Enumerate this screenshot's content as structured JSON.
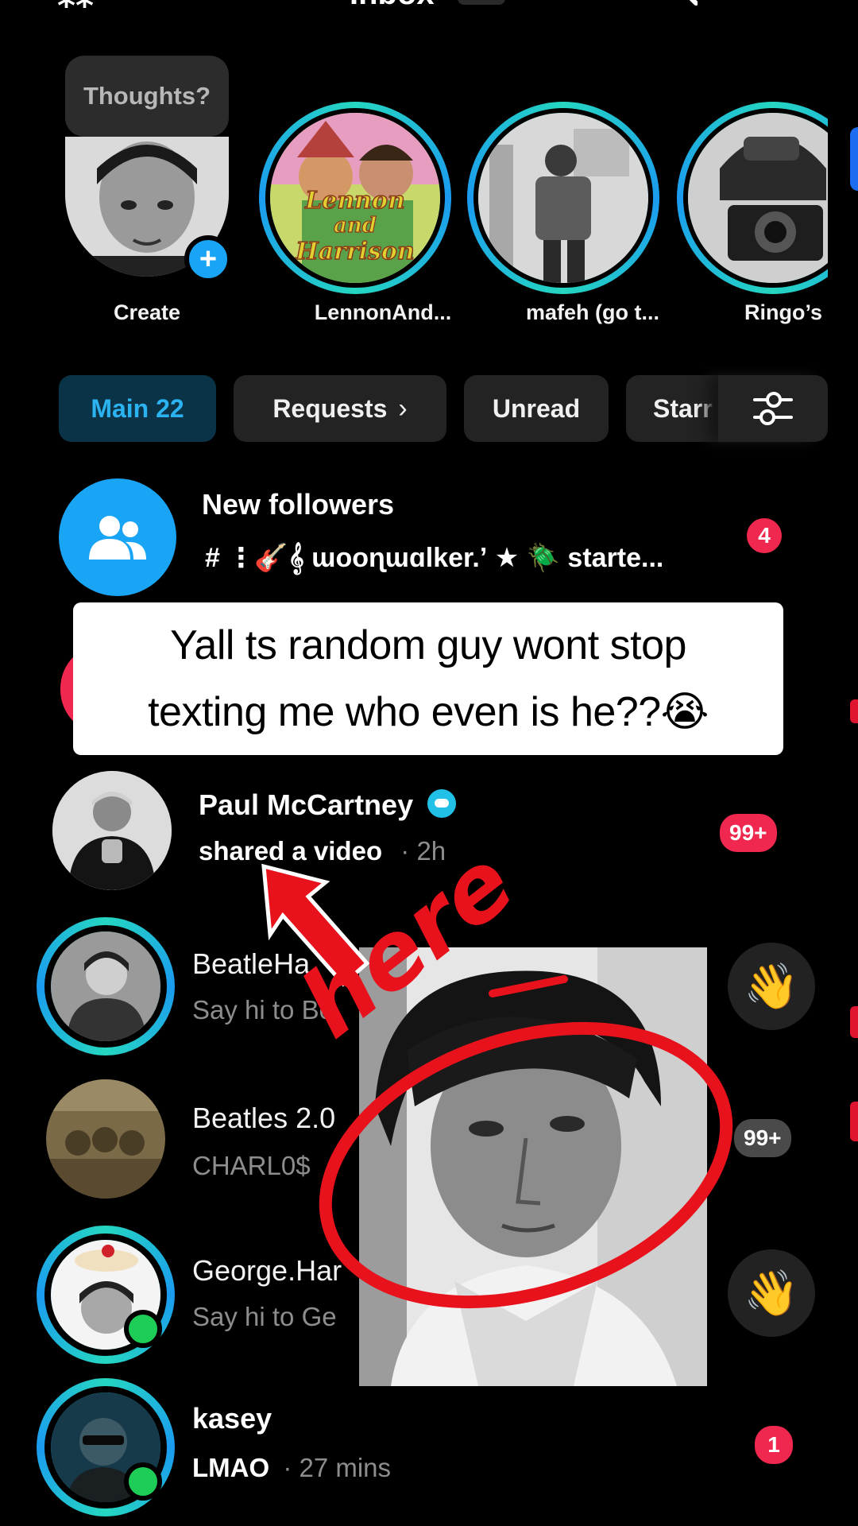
{
  "header": {
    "title": "Inbox",
    "search_icon": "search-icon"
  },
  "stories": {
    "thought_bubble": "Thoughts?",
    "items": [
      {
        "label": "Create"
      },
      {
        "label": "LennonAnd..."
      },
      {
        "label": "mafeh (go t..."
      },
      {
        "label": "Ringo’s left"
      }
    ],
    "lennon_art_text": [
      "Lennon",
      "and",
      "Harrison"
    ]
  },
  "tabs": {
    "main": "Main 22",
    "requests": "Requests",
    "unread": "Unread",
    "starred": "Starr",
    "filter_icon": "sliders-icon"
  },
  "rows": [
    {
      "title": "New followers",
      "subtitle": "# ⋮🎸𝄞 ɯooɳɯɑlker.ʼ ★ 🪲 starte...",
      "badge": "4"
    },
    {
      "title": "Paul McCartney",
      "subtitle": "shared a video",
      "time": "· 2h",
      "badge": "99+"
    },
    {
      "title": "BeatleHa",
      "subtitle": "Say hi to Be",
      "action": "wave"
    },
    {
      "title": "Beatles 2.0",
      "subtitle": "CHARL0$",
      "badge": "99+"
    },
    {
      "title": "George.Har",
      "subtitle": "Say hi to Ge",
      "action": "wave"
    },
    {
      "title": "kasey",
      "subtitle": "LMAO",
      "time": "· 27 mins",
      "badge": "1"
    }
  ],
  "overlay": {
    "caption_line1": "Yall ts random guy wont stop",
    "caption_line2": "texting me who even is he??😭",
    "annotation": "here"
  },
  "colors": {
    "accent_blue": "#1aa4f5",
    "badge_red": "#f0284f",
    "ring_teal": "#25d6c1",
    "online_green": "#1dcd57"
  }
}
